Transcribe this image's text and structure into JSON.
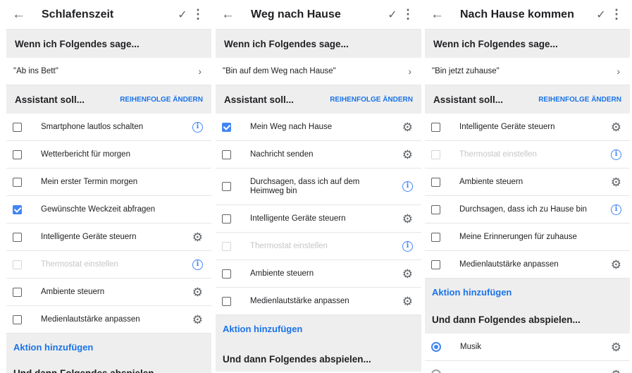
{
  "panels": [
    {
      "title": "Schlafenszeit",
      "when_header": "Wenn ich Folgendes sage...",
      "phrase": "\"Ab ins Bett\"",
      "assistant_header": "Assistant soll...",
      "reorder_label": "REIHENFOLGE ÄNDERN",
      "actions": [
        {
          "label": "Smartphone lautlos schalten",
          "state": "unchecked",
          "icon": "info"
        },
        {
          "label": "Wetterbericht für morgen",
          "state": "unchecked",
          "icon": ""
        },
        {
          "label": "Mein erster Termin morgen",
          "state": "unchecked",
          "icon": ""
        },
        {
          "label": "Gewünschte Weckzeit abfragen",
          "state": "checked",
          "icon": ""
        },
        {
          "label": "Intelligente Geräte steuern",
          "state": "unchecked",
          "icon": "gear"
        },
        {
          "label": "Thermostat einstellen",
          "state": "disabled",
          "icon": "info"
        },
        {
          "label": "Ambiente steuern",
          "state": "unchecked",
          "icon": "gear"
        },
        {
          "label": "Medienlautstärke anpassen",
          "state": "unchecked",
          "icon": "gear"
        }
      ],
      "add_action": "Aktion hinzufügen",
      "then_header": "Und dann Folgendes abspielen...",
      "media": []
    },
    {
      "title": "Weg nach Hause",
      "when_header": "Wenn ich Folgendes sage...",
      "phrase": "\"Bin auf dem Weg nach Hause\"",
      "assistant_header": "Assistant soll...",
      "reorder_label": "REIHENFOLGE ÄNDERN",
      "actions": [
        {
          "label": "Mein Weg nach Hause",
          "state": "checked",
          "icon": "gear"
        },
        {
          "label": "Nachricht senden",
          "state": "unchecked",
          "icon": "gear"
        },
        {
          "label": "Durchsagen, dass ich auf dem Heimweg bin",
          "state": "unchecked",
          "icon": "info"
        },
        {
          "label": "Intelligente Geräte steuern",
          "state": "unchecked",
          "icon": "gear"
        },
        {
          "label": "Thermostat einstellen",
          "state": "disabled",
          "icon": "info"
        },
        {
          "label": "Ambiente steuern",
          "state": "unchecked",
          "icon": "gear"
        },
        {
          "label": "Medienlautstärke anpassen",
          "state": "unchecked",
          "icon": "gear"
        }
      ],
      "add_action": "Aktion hinzufügen",
      "then_header": "Und dann Folgendes abspielen...",
      "media": []
    },
    {
      "title": "Nach Hause kommen",
      "when_header": "Wenn ich Folgendes sage...",
      "phrase": "\"Bin jetzt zuhause\"",
      "assistant_header": "Assistant soll...",
      "reorder_label": "REIHENFOLGE ÄNDERN",
      "actions": [
        {
          "label": "Intelligente Geräte steuern",
          "state": "unchecked",
          "icon": "gear"
        },
        {
          "label": "Thermostat einstellen",
          "state": "disabled",
          "icon": "info"
        },
        {
          "label": "Ambiente steuern",
          "state": "unchecked",
          "icon": "gear"
        },
        {
          "label": "Durchsagen, dass ich zu Hause bin",
          "state": "unchecked",
          "icon": "info"
        },
        {
          "label": "Meine Erinnerungen für zuhause",
          "state": "unchecked",
          "icon": ""
        },
        {
          "label": "Medienlautstärke anpassen",
          "state": "unchecked",
          "icon": "gear"
        }
      ],
      "add_action": "Aktion hinzufügen",
      "then_header": "Und dann Folgendes abspielen...",
      "media": [
        {
          "label": "Musik",
          "state": "selected",
          "icon": "gear"
        },
        {
          "label": "",
          "state": "unselected",
          "icon": "gear"
        }
      ]
    }
  ],
  "icons": {
    "back": "back-arrow-icon",
    "save": "check-icon",
    "more": "more-vert-icon",
    "chevron": "chevron-right-icon",
    "info": "info-icon",
    "gear": "gear-icon"
  },
  "colors": {
    "accent": "#4285f4",
    "link": "#1a73e8",
    "section_bg": "#eeeeee",
    "disabled_text": "#c6c6c6"
  }
}
